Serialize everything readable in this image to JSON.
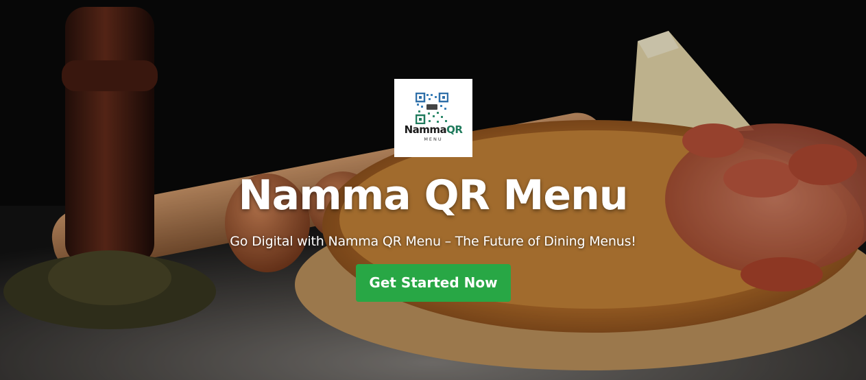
{
  "logo": {
    "brand_main": "Namma",
    "brand_accent": "QR",
    "brand_sub": "MENU",
    "accent_color": "#1f7a5c"
  },
  "hero": {
    "title": "Namma QR Menu",
    "subtitle": "Go Digital with Namma QR Menu – The Future of Dining Menus!",
    "cta_label": "Get Started Now",
    "cta_color": "#28a745"
  }
}
